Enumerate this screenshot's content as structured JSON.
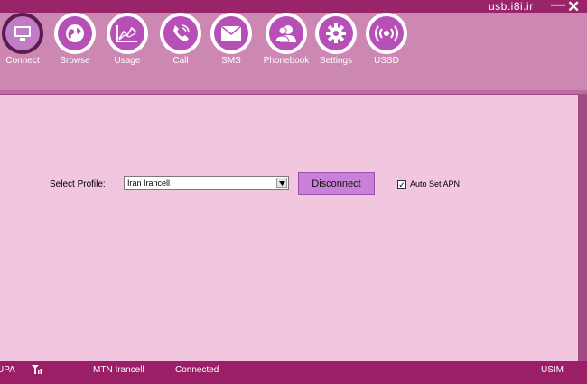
{
  "window": {
    "site": "usb.i8i.ir",
    "minimize": "—",
    "close": "✕"
  },
  "toolbar": {
    "items": [
      {
        "label": "Connect",
        "icon": "monitor-icon",
        "active": true
      },
      {
        "label": "Browse",
        "icon": "globe-icon"
      },
      {
        "label": "Usage",
        "icon": "chart-icon"
      },
      {
        "label": "Call",
        "icon": "phone-icon"
      },
      {
        "label": "SMS",
        "icon": "envelope-icon"
      },
      {
        "label": "Phonebook",
        "icon": "contacts-icon"
      },
      {
        "label": "Settings",
        "icon": "gear-icon"
      },
      {
        "label": "USSD",
        "icon": "signal-icon"
      }
    ]
  },
  "connect": {
    "select_label": "Select Profile:",
    "profile_value": "Iran Irancell",
    "disconnect_label": "Disconnect",
    "auto_apn_label": "Auto Set APN",
    "auto_apn_checked": "✓"
  },
  "status": {
    "mode": "UPA",
    "operator": "MTN Irancell",
    "connection": "Connected",
    "sim": "USIM"
  },
  "colors": {
    "frame": "#9a1f66",
    "toolbar": "#cc88b3",
    "panel": "#f2c6df",
    "icon_fill": "#b650b7",
    "button": "#c880d8"
  }
}
